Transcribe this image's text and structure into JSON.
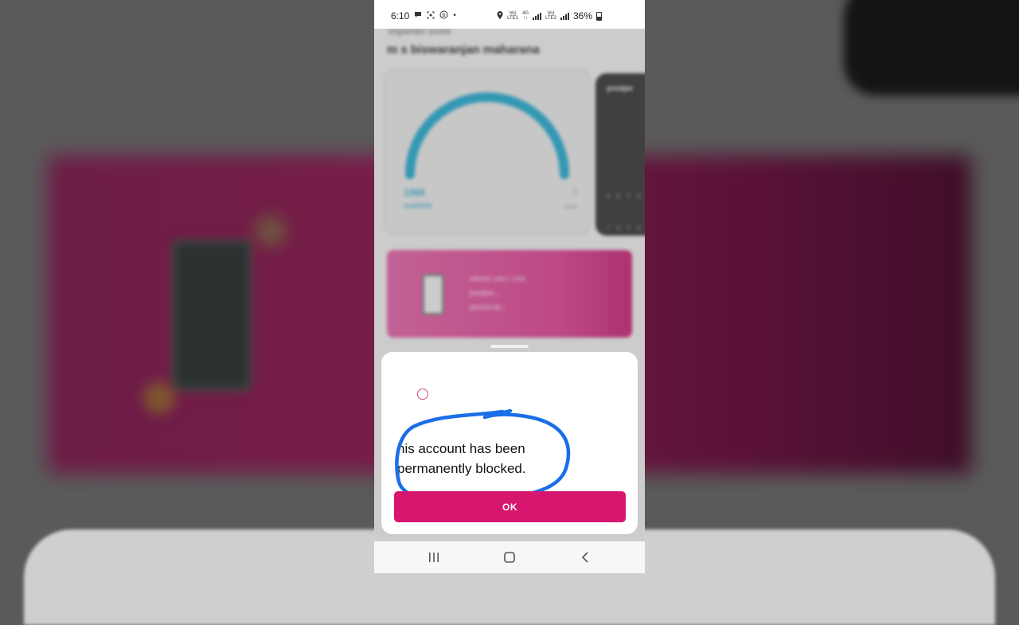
{
  "status_bar": {
    "time": "6:10",
    "battery": "36%",
    "network_tag": "Vo)) 4G LTE1 · Vo)) LTE2",
    "icons": [
      "message-icon",
      "screenshot-icon",
      "data-saver-icon",
      "dot-icon",
      "location-icon",
      "signal-icon",
      "battery-icon"
    ]
  },
  "app": {
    "subtitle": "experian score",
    "title": "m s biswaranjan maharana",
    "score_card": {
      "value": "1300",
      "label": "available",
      "max": "0",
      "max_label": "used",
      "arc_color": "#1aa5cc"
    },
    "dark_card": {
      "title": "postpe",
      "row1": "6 8 7 4",
      "row2": "7 8 7 3"
    },
    "promo": {
      "line1": "where can i use",
      "line2": "postpe...",
      "line3": "personal ›"
    }
  },
  "modal": {
    "message_line1": "his account has been",
    "message_line2": "permanently blocked.",
    "ok_label": "OK",
    "button_color": "#d6166f",
    "radio_color": "#e0457f"
  },
  "annotation": {
    "scribble_color": "#1a6fe8"
  },
  "nav_bar": {
    "recents_icon": "recents-icon",
    "home_icon": "home-icon",
    "back_icon": "back-icon"
  }
}
